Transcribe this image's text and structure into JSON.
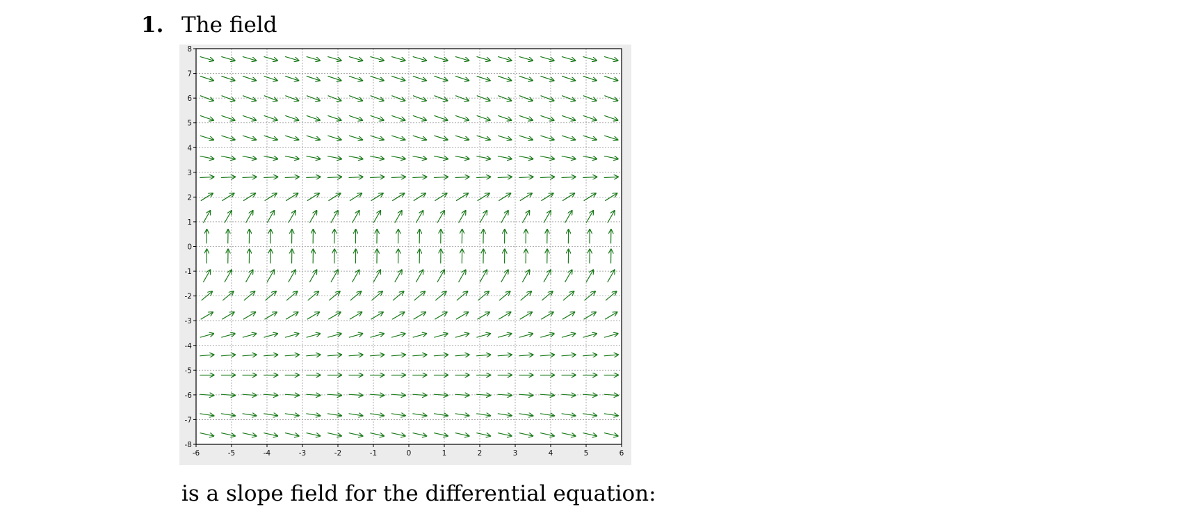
{
  "question": {
    "number": "1.",
    "lead_text": "The field",
    "follow_text": "is a slope field for the differential equation:"
  },
  "chart_data": {
    "type": "vector_field",
    "xlim": [
      -6,
      6
    ],
    "ylim": [
      -8,
      8
    ],
    "x_ticks": [
      "-6",
      "-5",
      "-4",
      "-3",
      "-2",
      "-1",
      "0",
      "1",
      "2",
      "3",
      "4",
      "5",
      "6"
    ],
    "y_ticks": [
      "8",
      "7",
      "6",
      "5",
      "4",
      "3",
      "2",
      "1",
      "0",
      "-1",
      "-2",
      "-3",
      "-4",
      "-5",
      "-6",
      "-7",
      "-8"
    ],
    "grid": true,
    "arrow_color": "#1a7a1a",
    "sample_x": [
      -5.7,
      -5.1,
      -4.5,
      -3.9,
      -3.3,
      -2.7,
      -2.1,
      -1.5,
      -0.9,
      -0.3,
      0.3,
      0.9,
      1.5,
      2.1,
      2.7,
      3.3,
      3.9,
      4.5,
      5.1,
      5.7
    ],
    "sample_y": [
      7.6,
      6.8,
      6.0,
      5.2,
      4.4,
      3.6,
      2.8,
      2.0,
      1.2,
      0.4,
      -0.4,
      -1.2,
      -2.0,
      -2.8,
      -3.6,
      -4.4,
      -5.2,
      -6.0,
      -6.8,
      -7.6
    ],
    "slope_by_row": [
      -0.42,
      -0.48,
      -0.55,
      -0.5,
      -0.45,
      -0.3,
      0.08,
      0.9,
      2.5,
      99,
      99,
      2.5,
      1.2,
      0.85,
      0.4,
      0.12,
      0.0,
      -0.1,
      -0.22,
      -0.32
    ]
  }
}
